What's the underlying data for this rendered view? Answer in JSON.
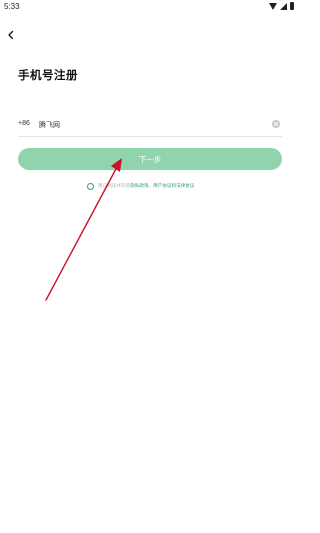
{
  "status_bar": {
    "time": "5:33"
  },
  "header": {
    "back_icon": "chevron-left-icon"
  },
  "page": {
    "title": "手机号注册"
  },
  "phone": {
    "country_code": "+86",
    "value": "腾飞网",
    "clear_icon": "clear-circle-icon"
  },
  "next_button": {
    "label": "下一步",
    "color": "#90d4ad"
  },
  "agreement": {
    "prefix": "我已阅读并同意",
    "links": "隐私政策、用户协议和法律协议",
    "accent_color": "#2fa865"
  },
  "annotation": {
    "color": "#c8102e"
  }
}
